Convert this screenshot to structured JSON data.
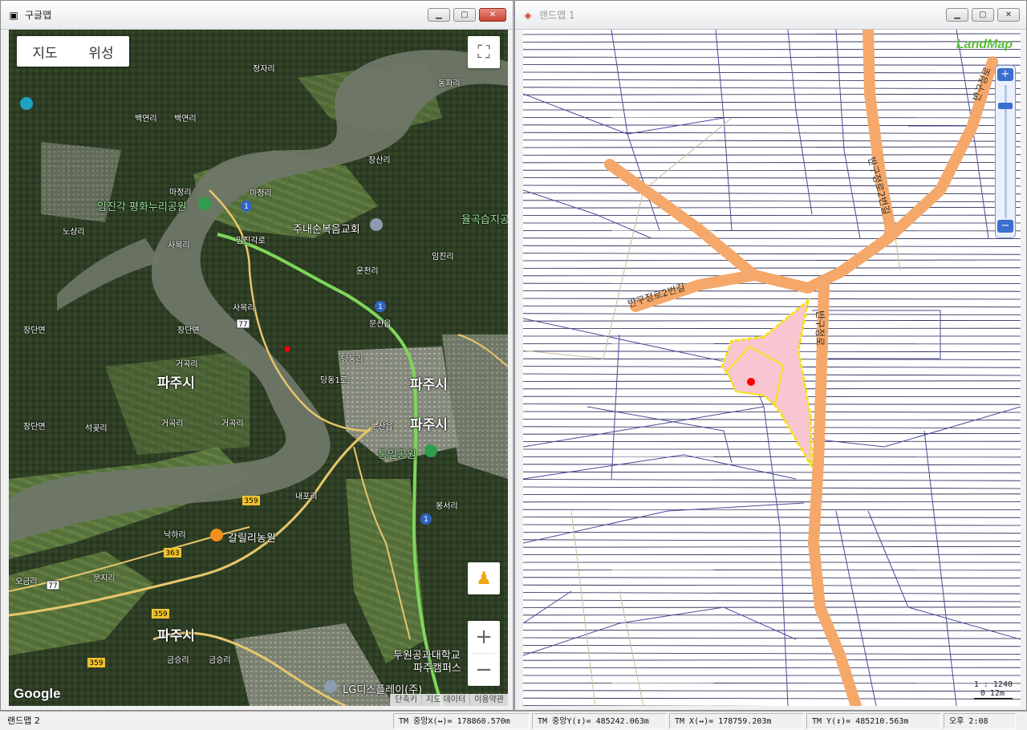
{
  "left_window": {
    "title": "구글맵",
    "map_type": {
      "map": "지도",
      "satellite": "위성"
    },
    "labels": {
      "jeongjari": "정자리",
      "dongpari": "동파리",
      "baekyeonri1": "백연리",
      "baekyeonri2": "백연리",
      "janfsanri": "장산리",
      "majeongri1": "마정리",
      "majeongri2": "마정리",
      "imjingak": "임진각 평화누리공원",
      "jounae": "주내순복음교회",
      "yulgok": "율곡습지공",
      "nosangri": "노상리",
      "sanmokri": "사목리",
      "imjingakro": "임진각로",
      "uncheonri": "운천리",
      "imjinri": "임진리",
      "samokri2": "사목리",
      "munsaneup": "문산읍",
      "jangdanmyeon1": "장단면",
      "jangdanmyeon2": "장단면",
      "dangdongri": "당동리",
      "dangdong1ro": "당동1로",
      "geojeokri1": "거곡리",
      "paju1": "파주시",
      "paju2": "파주시",
      "paju3": "파주시",
      "paju4": "파주시",
      "seongokri": "석곶리",
      "geojeokri2": "거곡리",
      "geojeokri3": "거곡리",
      "jangdanmyeon3": "장단면",
      "munsaneup2": "문산읍",
      "tongil": "통일공원",
      "naepori": "내포리",
      "bongseori": "봉서리",
      "galili": "갈릴리농원",
      "nakari": "낙하리",
      "ogeumri": "오금리",
      "munjiri": "문지리",
      "geumseungri1": "금승리",
      "geumseungri2": "금승리",
      "duwon": "두원공과대학교",
      "duwon2": "파주캠퍼스",
      "lg": "LG디스플레이(주)",
      "route1a": "1",
      "route1b": "1",
      "route1c": "1",
      "route77a": "77",
      "route77b": "77",
      "route359a": "359",
      "route359b": "359",
      "route359c": "359",
      "route363": "363"
    },
    "google_logo": "Google",
    "footer": {
      "shortcut": "단축키",
      "mapdata": "지도 데이터",
      "terms": "이용약관"
    }
  },
  "right_window": {
    "title": "랜드맵 1",
    "logo": "LandMap",
    "roads": {
      "road_a": "반구정로2번길",
      "road_b": "반구정로2번길",
      "road_c": "반구정로",
      "road_d": "반구정로"
    },
    "scale_ratio": "1 : 1240",
    "scale_bar": "0   12m"
  },
  "status_bar": {
    "app": "랜드맵 2",
    "tm_center_x": "TM 중앙X(↔)= 178860.570m",
    "tm_center_y": "TM 중앙Y(↕)= 485242.063m",
    "tm_x": "TM X(↔)= 178759.203m",
    "tm_y": "TM Y(↕)= 485210.563m",
    "clock": "오후 2:08"
  },
  "colors": {
    "road": "#f5a86a",
    "parcel_fill": "#f8c6d0",
    "parcel_outline": "#f4e21a",
    "marker": "#ff0000",
    "route_green": "#7fd65b"
  }
}
